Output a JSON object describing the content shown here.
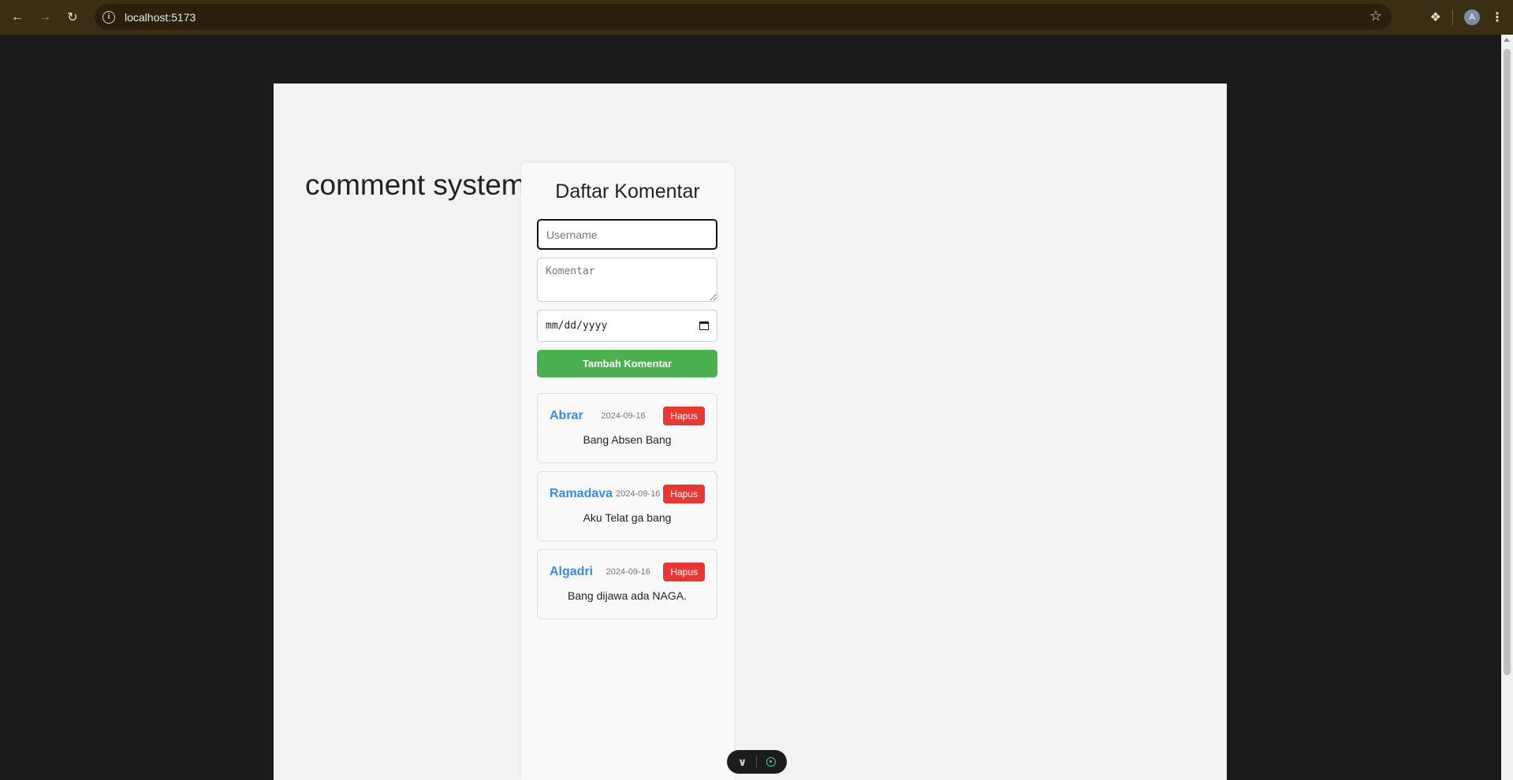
{
  "browser": {
    "url": "localhost:5173",
    "avatar_letter": "A",
    "icons": [
      "back-icon",
      "forward-icon",
      "reload-icon",
      "info-icon",
      "star-icon",
      "extensions-icon",
      "menu-icon"
    ]
  },
  "app": {
    "title": "comment system"
  },
  "panel": {
    "title": "Daftar Komentar",
    "username_placeholder": "Username",
    "komentar_placeholder": "Komentar",
    "date_placeholder": "mm/dd/yyyy",
    "add_button_label": "Tambah Komentar"
  },
  "comments": [
    {
      "username": "Abrar",
      "date": "2024-09-16",
      "text": "Bang Absen Bang",
      "delete_label": "Hapus"
    },
    {
      "username": "Ramadava",
      "date": "2024-09-16",
      "text": "Aku Telat ga bang",
      "delete_label": "Hapus"
    },
    {
      "username": "Algadri",
      "date": "2024-09-16",
      "text": "Bang dijawa ada NAGA.",
      "delete_label": "Hapus"
    }
  ],
  "colors": {
    "add_button": "#4caf50",
    "delete_button": "#e53935",
    "username": "#3a8be0"
  }
}
